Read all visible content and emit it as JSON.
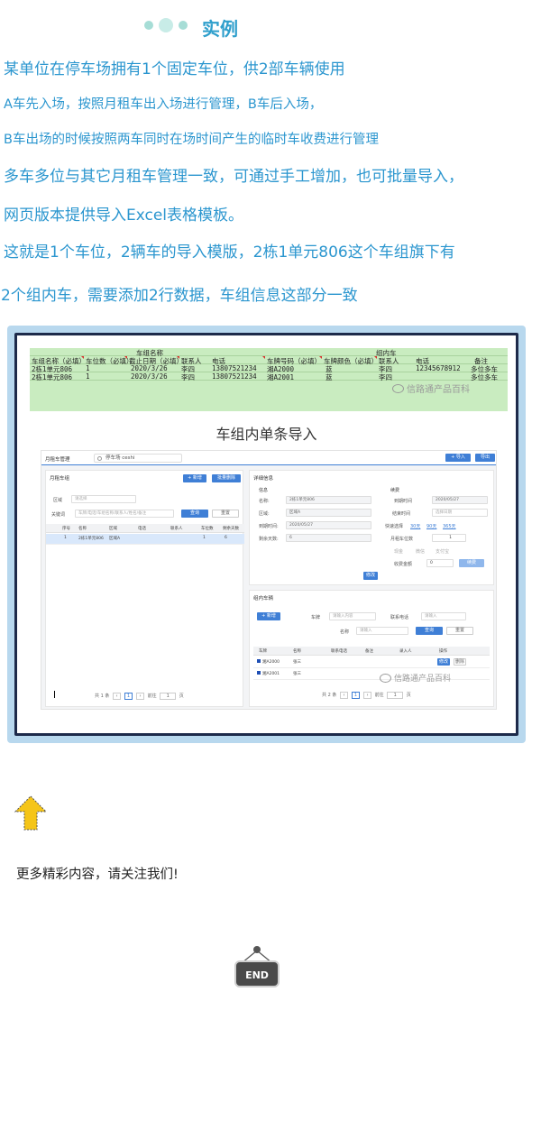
{
  "heading": {
    "title": "实例"
  },
  "paragraphs": [
    "某单位在停车场拥有1个固定车位，供2部车辆使用",
    "A车先入场，按照月租车出入场进行管理，B车后入场，",
    "B车出场的时候按照两车同时在场时间产生的临时车收费进行管理",
    "多车多位与其它月租车管理一致，可通过手工增加，也可批量导入，",
    "网页版本提供导入Excel表格模板。",
    "这就是1个车位，2辆车的导入模版，2栋1单元806这个车组旗下有",
    "2个组内车，需要添加2行数据，车组信息这部分一致"
  ],
  "sheet": {
    "group_caption": "车组名称",
    "incar_caption": "组内车",
    "headers": [
      "车组名称（必填）",
      "车位数（必填）",
      "截止日期（必填）",
      "联系人",
      "电话",
      "车牌号码（必填）",
      "车牌颜色（必填）",
      "联系人",
      "电话",
      "备注"
    ],
    "rows": [
      [
        "2栋1单元806",
        "1",
        "2020/3/26",
        "李四",
        "13807521234",
        "湘A2000",
        "蓝",
        "李四",
        "12345678912",
        "多位多车"
      ],
      [
        "2栋1单元806",
        "1",
        "2020/3/26",
        "李四",
        "13807521234",
        "湘A2001",
        "蓝",
        "李四",
        "",
        "多位多车"
      ]
    ],
    "watermark": "信路通产品百科"
  },
  "import_title": "车组内单条导入",
  "app": {
    "brand": "月租车管理",
    "parking_lot": "停车场 ceshi",
    "import_btn": "+ 导入",
    "export_btn": "导出",
    "left": {
      "title": "月租车组",
      "add_btn": "+ 新增",
      "batch_delete_btn": "批量删除",
      "area_label": "区域",
      "area_placeholder": "请选择",
      "keyword_label": "关键词",
      "keyword_placeholder": "车牌/电话/车组名称/联系人/姓名/备注",
      "search_btn": "查询",
      "reset_btn": "重置",
      "columns": [
        "序号",
        "名称",
        "区域",
        "电话",
        "联系人",
        "车位数",
        "剩余天数"
      ],
      "rows": [
        [
          "1",
          "2栋1单元806",
          "区域A",
          "",
          "",
          "1",
          "6"
        ]
      ],
      "pager_total": "共 1 条",
      "pager_page": "1",
      "pager_goto": "前往",
      "pager_goto_value": "1",
      "pager_unit": "页"
    },
    "detail": {
      "title": "详细信息",
      "info_title": "信息",
      "name_label": "名称:",
      "name_value": "2栋1单元806",
      "area_label": "区域:",
      "area_value": "区域A",
      "expire_label": "到期时间:",
      "expire_value": "2020/05/27",
      "remain_label": "剩余天数:",
      "remain_value": "6",
      "edit_btn": "修改",
      "renew_title": "续费",
      "renew_expire_label": "到期时间",
      "renew_expire_value": "2020/05/27",
      "renew_end_label": "结束时间",
      "renew_end_placeholder": "选择日期",
      "quick_label": "快速选择",
      "quick_30": "30天",
      "quick_90": "90天",
      "quick_365": "365天",
      "unit_label": "月租车位数",
      "unit_value": "1",
      "opt_cash": "现金",
      "opt_wechat": "微信",
      "opt_alipay": "支付宝",
      "fee_label": "收费金额",
      "fee_value": "0",
      "confirm_btn": "续费"
    },
    "incar": {
      "title": "组内车辆",
      "add_btn": "+ 新增",
      "plate_label": "车牌",
      "plate_placeholder": "请输入内容",
      "phone_label": "联系电话",
      "phone_placeholder": "请输入",
      "name_label": "名称",
      "name_placeholder": "请输入",
      "search_btn": "查询",
      "reset_btn": "重置",
      "columns": [
        "车牌",
        "名称",
        "联系电话",
        "备注",
        "录入人",
        "操作"
      ],
      "rows": [
        [
          "湘A2000",
          "张三"
        ],
        [
          "湘A2001",
          "张三"
        ]
      ],
      "edit_btn": "修改",
      "delete_btn": "删除",
      "pager_total": "共 2 条",
      "pager_page": "1",
      "pager_goto": "前往",
      "pager_goto_value": "1",
      "pager_unit": "页",
      "watermark": "信路通产品百科"
    }
  },
  "follow_text": "更多精彩内容，请关注我们!",
  "end_label": "END"
}
